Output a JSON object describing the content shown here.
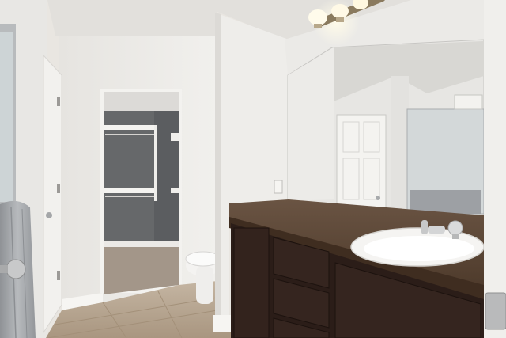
{
  "scene": {
    "subject": "bathroom-interior",
    "colors": {
      "ceiling": "#e4e2de",
      "wall": "#ecebe8",
      "closet_wall": "#6b6c6e",
      "cabinet": "#2a1c17",
      "countertop": "#5a4636",
      "sink": "#f4f3f1",
      "floor_tile": "#b9a792",
      "carpet": "#a1958a",
      "towel": "#a5a8ab",
      "door": "#f3f2ef",
      "mirror_ceiling": "#d9d8d4",
      "chrome": "#c9cacb",
      "light_glow": "#fff6dd"
    },
    "icons": [
      "door-knob-icon",
      "faucet-icon",
      "outlet-icon",
      "vanity-light-icon"
    ]
  }
}
